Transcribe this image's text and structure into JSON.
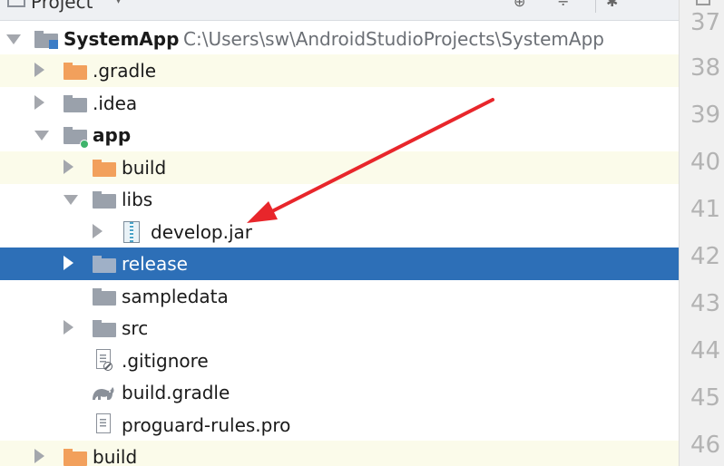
{
  "header": {
    "title": "Project",
    "caret": "▾"
  },
  "tree": {
    "root": {
      "name": "SystemApp",
      "path": "C:\\Users\\sw\\AndroidStudioProjects\\SystemApp"
    },
    "items": [
      {
        "label": ".gradle",
        "expanded": false,
        "icon": "orange-folder-icon"
      },
      {
        "label": ".idea",
        "expanded": false,
        "icon": "folder-icon"
      },
      {
        "label": "app",
        "expanded": true,
        "icon": "module-folder-icon"
      },
      {
        "label": "build",
        "expanded": false,
        "icon": "orange-folder-icon"
      },
      {
        "label": "libs",
        "expanded": true,
        "icon": "folder-icon"
      },
      {
        "label": "develop.jar",
        "expanded": false,
        "icon": "jar-icon"
      },
      {
        "label": "release",
        "expanded": false,
        "icon": "folder-icon",
        "selected": true
      },
      {
        "label": "sampledata",
        "icon": "folder-icon"
      },
      {
        "label": "src",
        "expanded": false,
        "icon": "folder-icon"
      },
      {
        "label": ".gitignore",
        "icon": "gitignore-file-icon"
      },
      {
        "label": "build.gradle",
        "icon": "gradle-icon"
      },
      {
        "label": "proguard-rules.pro",
        "icon": "text-file-icon"
      },
      {
        "label": "build",
        "expanded": false,
        "icon": "orange-folder-icon"
      }
    ]
  },
  "gutter": {
    "line_numbers": [
      "37",
      "38",
      "39",
      "40",
      "41",
      "42",
      "43",
      "44",
      "45",
      "46"
    ]
  },
  "colors": {
    "selection": "#2d6fb7",
    "stripe": "#fbfbea",
    "annotation_arrow": "#e8262b"
  }
}
